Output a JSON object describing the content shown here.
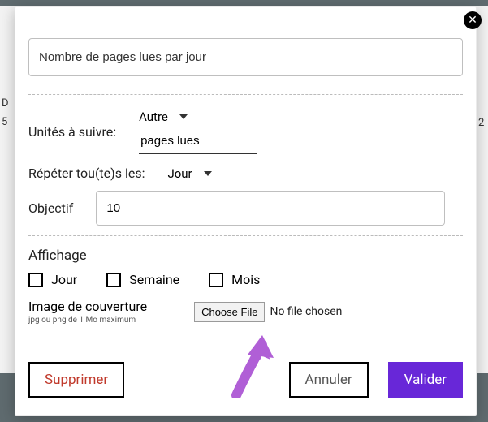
{
  "bg": {
    "left_d": "D",
    "left_5": "5",
    "right_2": "2"
  },
  "modal": {
    "title_value": "Nombre de pages lues par jour",
    "units_label": "Unités à suivre:",
    "units_select": "Autre",
    "units_value": "pages lues",
    "repeat_label": "Répéter tou(te)s les:",
    "repeat_select": "Jour",
    "goal_label": "Objectif",
    "goal_value": "10",
    "display_title": "Affichage",
    "check_day": "Jour",
    "check_week": "Semaine",
    "check_month": "Mois",
    "cover_title": "Image de couverture",
    "cover_hint": "jpg ou png de 1 Mo maximum",
    "choose_file": "Choose File",
    "no_file": "No file chosen",
    "delete": "Supprimer",
    "cancel": "Annuler",
    "submit": "Valider"
  }
}
